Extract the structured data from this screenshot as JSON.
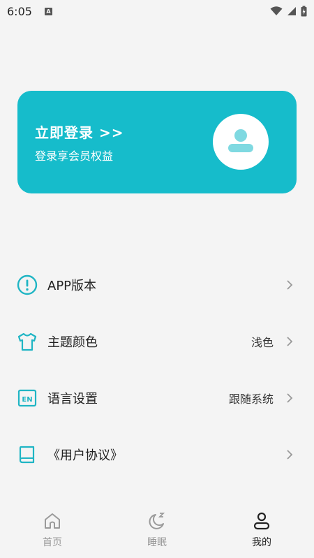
{
  "status_bar": {
    "time": "6:05",
    "notification_letter": "A"
  },
  "login_card": {
    "title": "立即登录 >>",
    "subtitle": "登录享会员权益",
    "background_color": "#16bccb"
  },
  "menu": [
    {
      "icon": "info-circle-icon",
      "label": "APP版本",
      "value": ""
    },
    {
      "icon": "tshirt-icon",
      "label": "主题颜色",
      "value": "浅色"
    },
    {
      "icon": "language-en-icon",
      "label": "语言设置",
      "value": "跟随系统"
    },
    {
      "icon": "book-icon",
      "label": "《用户协议》",
      "value": ""
    }
  ],
  "bottom_nav": [
    {
      "icon": "home-icon",
      "label": "首页",
      "active": false
    },
    {
      "icon": "moon-sleep-icon",
      "label": "睡眠",
      "active": false
    },
    {
      "icon": "user-icon",
      "label": "我的",
      "active": true
    }
  ],
  "colors": {
    "accent": "#16bccb",
    "icon_teal": "#1fb5c4",
    "inactive": "#9a9a9a"
  }
}
